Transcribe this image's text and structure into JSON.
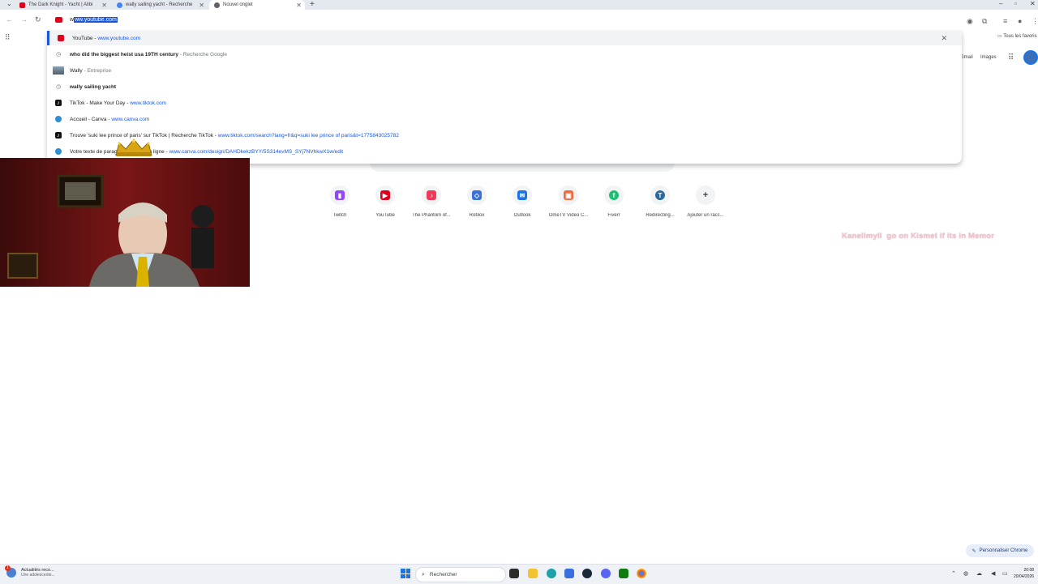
{
  "tabs": [
    {
      "title": "The Dark Knight - Yacht | Alibi",
      "favicon": "youtube-icon",
      "color": "#e0001b"
    },
    {
      "title": "wally sailing yacht - Recherche",
      "favicon": "google-icon",
      "color": "#4285f4"
    },
    {
      "title": "Nouvel onglet",
      "favicon": "chrome-icon",
      "color": "#5f6368"
    }
  ],
  "omnibox": {
    "prefix": "w",
    "selected": "ww.youtube.com"
  },
  "suggestions": [
    {
      "title": "YouTube",
      "sep": " - ",
      "detail": "www.youtube.com",
      "icon": "youtube-icon"
    },
    {
      "title": "who did the biggest heist usa 19TH century",
      "sep": " - ",
      "detail": "Recherche Google",
      "icon": "history-icon"
    },
    {
      "title": "Wally",
      "sep": " - ",
      "detail": "Entreprise",
      "icon": "image-thumbnail"
    },
    {
      "title": "wally sailing yacht",
      "sep": "",
      "detail": "",
      "icon": "history-icon"
    },
    {
      "title": "TikTok - Make Your Day",
      "sep": " - ",
      "detail": "www.tiktok.com",
      "icon": "tiktok-icon"
    },
    {
      "title": "Accueil - Canva",
      "sep": " - ",
      "detail": "www.canva.com",
      "icon": "canva-icon"
    },
    {
      "title": "Trouve 'suki lee prince of paris' sur TikTok | Recherche TikTok",
      "sep": " - ",
      "detail": "www.tiktok.com/search?lang=fr&q=suki lee prince of paris&t=1775843025782",
      "icon": "tiktok-icon"
    },
    {
      "title": "Votre texte de parag...eau blanc en ligne",
      "sep": " - ",
      "detail": "www.canva.com/design/DAHDkekzBYY/5S314evMS_SYj7NVhkwX1w/edit",
      "icon": "canva-icon"
    }
  ],
  "bookmarks": {
    "right_label": "Tous les favoris"
  },
  "google": {
    "gmail": "Gmail",
    "images": "Images"
  },
  "shortcuts": [
    {
      "label": "Twitch",
      "icon": "twitch-icon",
      "color": "#9146ff",
      "glyph": "▮"
    },
    {
      "label": "YouTube",
      "icon": "youtube-icon",
      "color": "#e0001b",
      "glyph": "▶"
    },
    {
      "label": "The Phantom of...",
      "icon": "music-icon",
      "color": "#f2395b",
      "glyph": "♪"
    },
    {
      "label": "Roblox",
      "icon": "roblox-icon",
      "color": "#3a6fe0",
      "glyph": "◇"
    },
    {
      "label": "Outlook",
      "icon": "outlook-icon",
      "color": "#1a73e8",
      "glyph": "✉"
    },
    {
      "label": "OmeTV Video C...",
      "icon": "ometv-icon",
      "color": "#ef6c3a",
      "glyph": "▣"
    },
    {
      "label": "Fiverr",
      "icon": "fiverr-icon",
      "color": "#1dbf73",
      "glyph": "f"
    },
    {
      "label": "Redirecting...",
      "icon": "redirect-icon",
      "color": "#2b6a9c",
      "glyph": "T"
    },
    {
      "label": "Ajouter un racc...",
      "icon": "plus-icon",
      "color": "#f1f3f4",
      "glyph": "+"
    }
  ],
  "overlay": {
    "name": "Kanellmyll",
    "message": "go on Kismet if its in Memor"
  },
  "customize_label": "Personnaliser Chrome",
  "taskbar": {
    "news_title": "Actualités reco...",
    "news_sub": "Une adolescente...",
    "news_badge": "1",
    "search_placeholder": "Rechercher",
    "time": "20:08",
    "date": "20/04/2026"
  }
}
